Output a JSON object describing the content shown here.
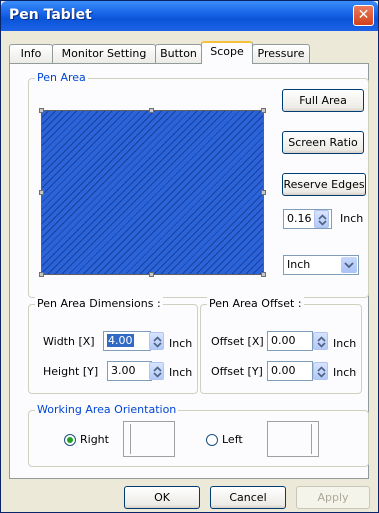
{
  "window": {
    "title": "Pen Tablet",
    "close_glyph": "✕"
  },
  "tabs": [
    {
      "label": "Info"
    },
    {
      "label": "Monitor Setting"
    },
    {
      "label": "Button"
    },
    {
      "label": "Scope"
    },
    {
      "label": "Pressure"
    }
  ],
  "active_tab": "Scope",
  "pen_area": {
    "legend": "Pen Area",
    "full_area": "Full Area",
    "screen_ratio": "Screen Ratio",
    "reserve_edges": "Reserve Edges",
    "edge_value": "0.16",
    "edge_unit": "Inch",
    "unit_select": "Inch"
  },
  "dimensions": {
    "legend": "Pen Area Dimensions :",
    "width_label": "Width [X]",
    "width_value": "4.00",
    "width_unit": "Inch",
    "height_label": "Height [Y]",
    "height_value": "3.00",
    "height_unit": "Inch"
  },
  "offset": {
    "legend": "Pen Area Offset :",
    "x_label": "Offset [X]",
    "x_value": "0.00",
    "x_unit": "Inch",
    "y_label": "Offset [Y]",
    "y_value": "0.00",
    "y_unit": "Inch"
  },
  "orientation": {
    "legend": "Working Area Orientation",
    "right_label": "Right",
    "left_label": "Left",
    "selected": "Right"
  },
  "footer": {
    "ok": "OK",
    "cancel": "Cancel",
    "apply": "Apply"
  },
  "colors": {
    "titlebar": "#0b54d8",
    "pen_area_fill": "#2b63d9",
    "legend_text": "#0046d5"
  }
}
